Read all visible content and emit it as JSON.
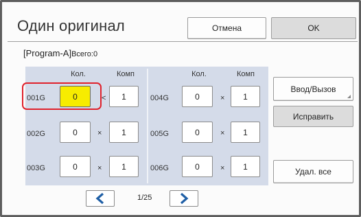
{
  "dialog": {
    "title": "Один оригинал",
    "cancel_label": "Отмена",
    "ok_label": "OK"
  },
  "program": {
    "name": "[Program-A]",
    "total_label": "Всего:",
    "total_value": "0"
  },
  "grid": {
    "col_copies": "Кол.",
    "col_sets": "Комп",
    "groups": [
      {
        "label": "001G",
        "copies": "0",
        "sets": "1",
        "sep": "<"
      },
      {
        "label": "002G",
        "copies": "0",
        "sets": "1",
        "sep": "×"
      },
      {
        "label": "003G",
        "copies": "0",
        "sets": "1",
        "sep": "×"
      },
      {
        "label": "004G",
        "copies": "0",
        "sets": "1",
        "sep": "×"
      },
      {
        "label": "005G",
        "copies": "0",
        "sets": "1",
        "sep": "×"
      },
      {
        "label": "006G",
        "copies": "0",
        "sets": "1",
        "sep": "×"
      }
    ],
    "selected_group": "001G",
    "highlight_color": "#f7ec00",
    "selection_ring_color": "#e0212b"
  },
  "side": {
    "entry_label": "Ввод/Вызов",
    "edit_label": "Исправить",
    "clear_label": "Удал. все"
  },
  "pager": {
    "prev_icon": "chevron-left-icon",
    "next_icon": "chevron-right-icon",
    "page_text": "1/25",
    "accent": "#1f5fa6"
  }
}
